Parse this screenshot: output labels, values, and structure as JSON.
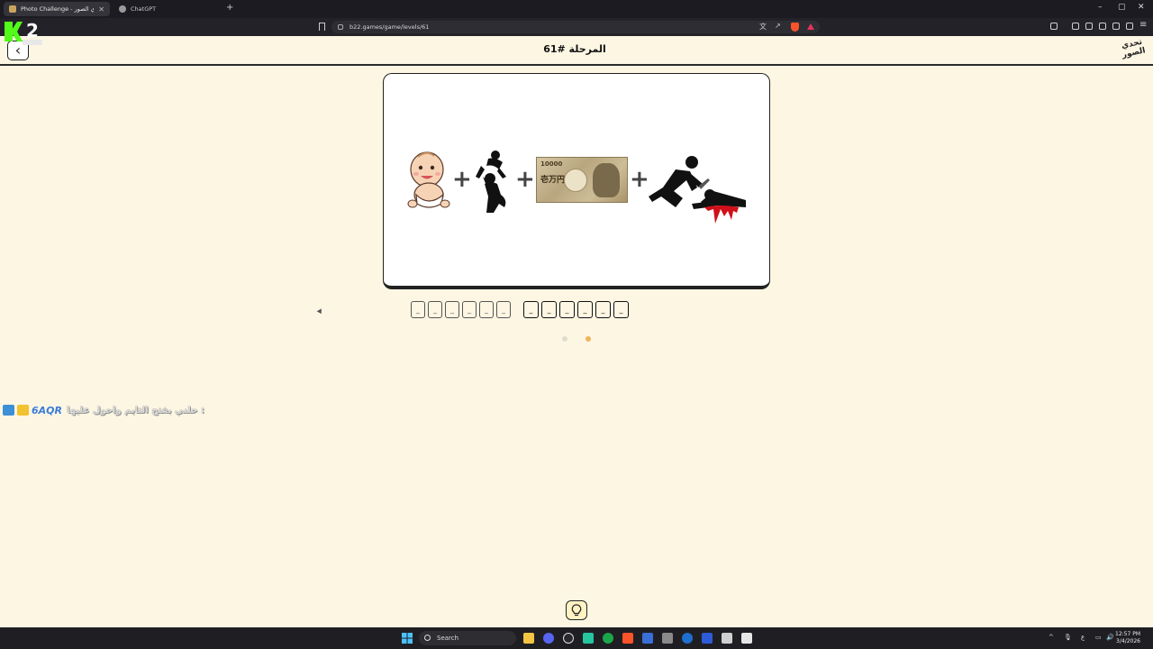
{
  "browser": {
    "tabs": [
      {
        "title": "Photo Challenge - تحدي الصور",
        "active": true
      },
      {
        "title": "ChatGPT",
        "active": false
      }
    ],
    "new_tab": "+",
    "url": "b22.games/game/levels/61",
    "window_controls": [
      "–",
      "▢",
      "✕"
    ]
  },
  "stream_overlay": {
    "kick_count": "2"
  },
  "game": {
    "back_icon": "chevron-left-icon",
    "level_title": "المرحلة #61",
    "logo_text": "تحدي الصور",
    "puzzle": {
      "items": [
        "baby",
        "mother-lifting-child",
        "yen-banknote",
        "attacker-and-victim"
      ],
      "plus": "+",
      "yen_note_number": "10000",
      "yen_note_kanji": "壱万円"
    },
    "answer": {
      "word1_slots": [
        "_",
        "_",
        "_",
        "_",
        "_",
        "_"
      ],
      "word2_slots": [
        "_",
        "_",
        "_",
        "_",
        "_",
        "_"
      ]
    },
    "pagination_dots": 2,
    "active_dot": 1,
    "accent_color": "#f0b45a"
  },
  "chat_overlay": {
    "code": "6AQR",
    "message": "حلني بفتح التايم واحول عليها :"
  },
  "taskbar": {
    "search_placeholder": "Search",
    "clock_time": "12:57 PM",
    "clock_date": "3/4/2026",
    "lang": "ع"
  }
}
